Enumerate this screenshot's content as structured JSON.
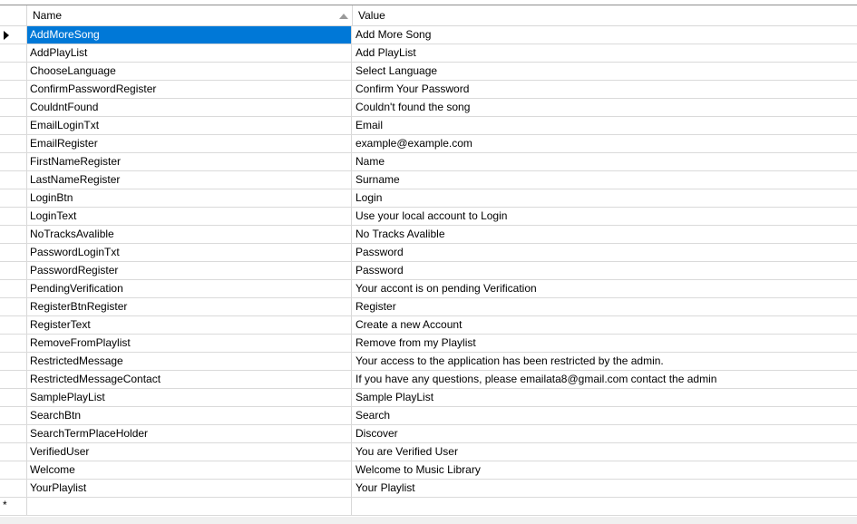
{
  "header": {
    "name_label": "Name",
    "value_label": "Value",
    "sort": "ascending"
  },
  "rows": [
    {
      "name": "AddMoreSong",
      "value": "Add More Song"
    },
    {
      "name": "AddPlayList",
      "value": "Add PlayList"
    },
    {
      "name": "ChooseLanguage",
      "value": "Select Language"
    },
    {
      "name": "ConfirmPasswordRegister",
      "value": "Confirm Your Password"
    },
    {
      "name": "CouldntFound",
      "value": "Couldn't found the song"
    },
    {
      "name": "EmailLoginTxt",
      "value": "Email"
    },
    {
      "name": "EmailRegister",
      "value": "example@example.com"
    },
    {
      "name": "FirstNameRegister",
      "value": "Name"
    },
    {
      "name": "LastNameRegister",
      "value": "Surname"
    },
    {
      "name": "LoginBtn",
      "value": "Login"
    },
    {
      "name": "LoginText",
      "value": "Use your local account to Login"
    },
    {
      "name": "NoTracksAvalible",
      "value": "No Tracks Avalible"
    },
    {
      "name": "PasswordLoginTxt",
      "value": "Password"
    },
    {
      "name": "PasswordRegister",
      "value": "Password"
    },
    {
      "name": "PendingVerification",
      "value": "Your accont is on pending Verification"
    },
    {
      "name": "RegisterBtnRegister",
      "value": "Register"
    },
    {
      "name": "RegisterText",
      "value": "Create a new Account"
    },
    {
      "name": "RemoveFromPlaylist",
      "value": "Remove from my Playlist"
    },
    {
      "name": "RestrictedMessage",
      "value": "Your access to the application has been restricted by the admin."
    },
    {
      "name": "RestrictedMessageContact",
      "value": "If you have any questions, please emailata8@gmail.com  contact the admin"
    },
    {
      "name": "SamplePlayList",
      "value": "Sample PlayList"
    },
    {
      "name": "SearchBtn",
      "value": "Search"
    },
    {
      "name": "SearchTermPlaceHolder",
      "value": "Discover"
    },
    {
      "name": "VerifiedUser",
      "value": "You are Verified User"
    },
    {
      "name": "Welcome",
      "value": "Welcome to Music Library"
    },
    {
      "name": "YourPlaylist",
      "value": "Your Playlist"
    }
  ],
  "selected_row": 0,
  "new_row_marker": "*",
  "colors": {
    "selection": "#0078d7",
    "gridline": "#dadada"
  },
  "icons": {
    "sort": "sort-ascending-icon",
    "current_row": "row-pointer-icon"
  }
}
